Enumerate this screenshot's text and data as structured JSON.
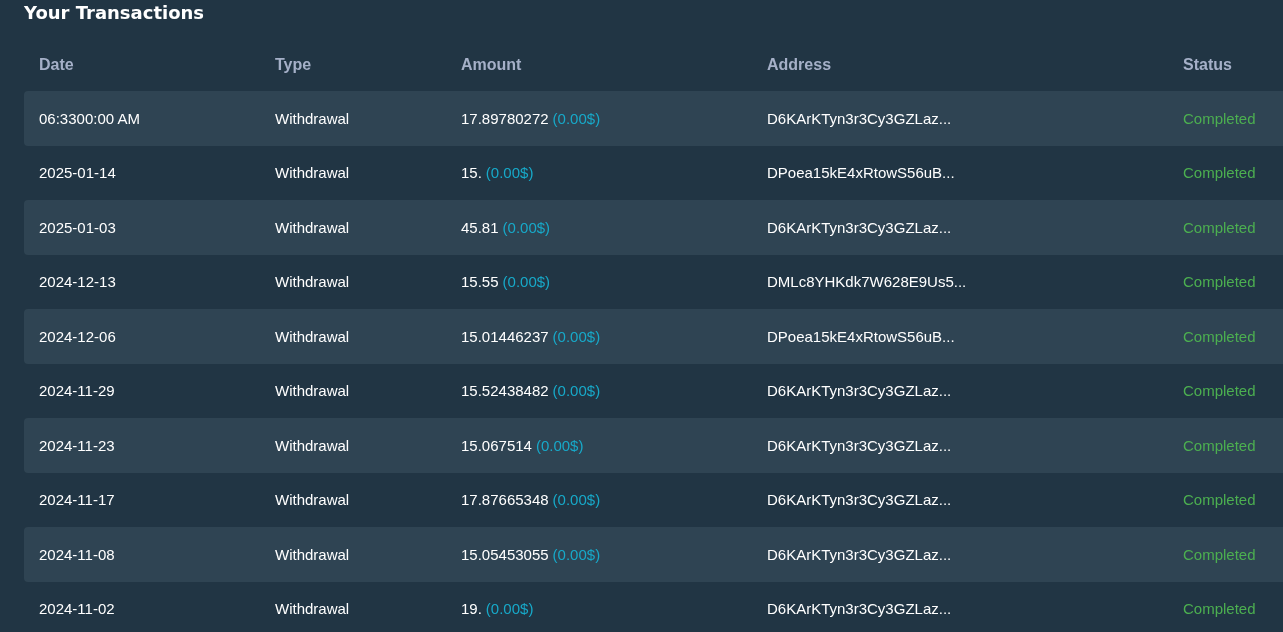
{
  "title": "Your Transactions",
  "table": {
    "columns": [
      "Date",
      "Type",
      "Amount",
      "Address",
      "Status"
    ],
    "rows": [
      {
        "date": "06:3300:00 AM",
        "type": "Withdrawal",
        "amount": "17.89780272",
        "amount_usd": "(0.00$)",
        "address": "D6KArKTyn3r3Cy3GZLaz...",
        "status": "Completed"
      },
      {
        "date": "2025-01-14",
        "type": "Withdrawal",
        "amount": "15.",
        "amount_usd": "(0.00$)",
        "address": "DPoea15kE4xRtowS56uB...",
        "status": "Completed"
      },
      {
        "date": "2025-01-03",
        "type": "Withdrawal",
        "amount": "45.81",
        "amount_usd": "(0.00$)",
        "address": "D6KArKTyn3r3Cy3GZLaz...",
        "status": "Completed"
      },
      {
        "date": "2024-12-13",
        "type": "Withdrawal",
        "amount": "15.55",
        "amount_usd": "(0.00$)",
        "address": "DMLc8YHKdk7W628E9Us5...",
        "status": "Completed"
      },
      {
        "date": "2024-12-06",
        "type": "Withdrawal",
        "amount": "15.01446237",
        "amount_usd": "(0.00$)",
        "address": "DPoea15kE4xRtowS56uB...",
        "status": "Completed"
      },
      {
        "date": "2024-11-29",
        "type": "Withdrawal",
        "amount": "15.52438482",
        "amount_usd": "(0.00$)",
        "address": "D6KArKTyn3r3Cy3GZLaz...",
        "status": "Completed"
      },
      {
        "date": "2024-11-23",
        "type": "Withdrawal",
        "amount": "15.067514",
        "amount_usd": "(0.00$)",
        "address": "D6KArKTyn3r3Cy3GZLaz...",
        "status": "Completed"
      },
      {
        "date": "2024-11-17",
        "type": "Withdrawal",
        "amount": "17.87665348",
        "amount_usd": "(0.00$)",
        "address": "D6KArKTyn3r3Cy3GZLaz...",
        "status": "Completed"
      },
      {
        "date": "2024-11-08",
        "type": "Withdrawal",
        "amount": "15.05453055",
        "amount_usd": "(0.00$)",
        "address": "D6KArKTyn3r3Cy3GZLaz...",
        "status": "Completed"
      },
      {
        "date": "2024-11-02",
        "type": "Withdrawal",
        "amount": "19.",
        "amount_usd": "(0.00$)",
        "address": "D6KArKTyn3r3Cy3GZLaz...",
        "status": "Completed"
      }
    ]
  }
}
